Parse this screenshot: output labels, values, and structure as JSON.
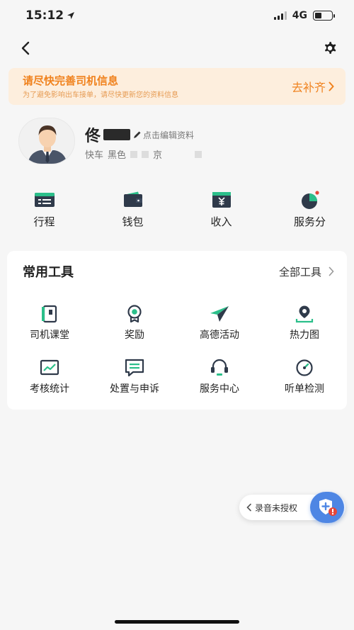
{
  "status": {
    "time": "15:12",
    "network": "4G"
  },
  "banner": {
    "title": "请尽快完善司机信息",
    "subtitle": "为了避免影响出车接单，请尽快更新您的资料信息",
    "action": "去补齐"
  },
  "profile": {
    "name": "佟",
    "edit_hint": "点击编辑资料",
    "car_type": "快车",
    "car_color": "黑色",
    "plate_prefix": "京"
  },
  "quick_actions": [
    {
      "label": "行程",
      "icon": "trip-icon"
    },
    {
      "label": "钱包",
      "icon": "wallet-icon"
    },
    {
      "label": "收入",
      "icon": "income-icon"
    },
    {
      "label": "服务分",
      "icon": "service-score-icon"
    }
  ],
  "tools": {
    "title": "常用工具",
    "all_label": "全部工具",
    "items": [
      {
        "label": "司机课堂",
        "icon": "classroom-icon"
      },
      {
        "label": "奖励",
        "icon": "reward-icon"
      },
      {
        "label": "高德活动",
        "icon": "activity-icon"
      },
      {
        "label": "热力图",
        "icon": "heatmap-icon"
      },
      {
        "label": "考核统计",
        "icon": "stats-icon"
      },
      {
        "label": "处置与申诉",
        "icon": "appeal-icon"
      },
      {
        "label": "服务中心",
        "icon": "service-center-icon"
      },
      {
        "label": "听单检测",
        "icon": "order-check-icon"
      }
    ]
  },
  "recording": {
    "label": "录音未授权"
  },
  "colors": {
    "accent_green": "#2bbf8a",
    "icon_dark": "#2f3a4a",
    "banner_orange": "#f0821e",
    "float_blue": "#4e86e4",
    "alert_red": "#e5473a"
  }
}
